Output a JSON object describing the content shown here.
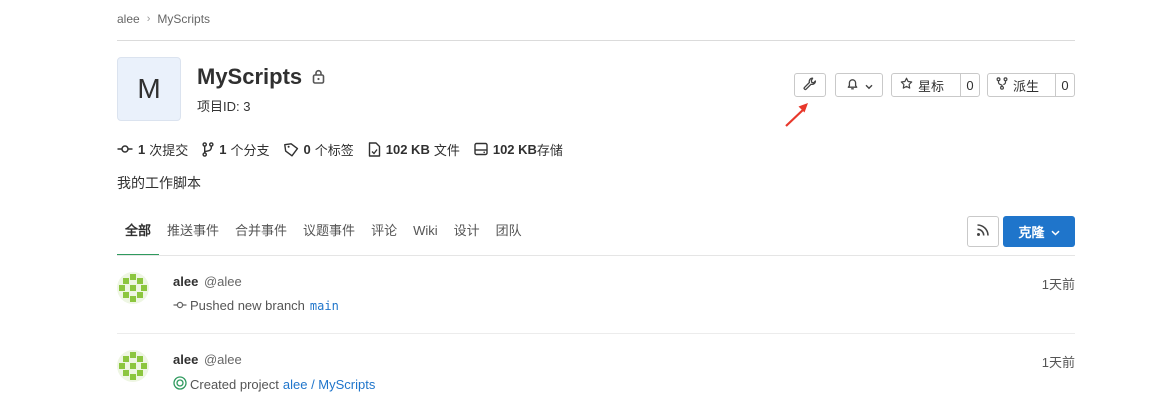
{
  "breadcrumb": {
    "user": "alee",
    "separator": "›",
    "project": "MyScripts"
  },
  "project": {
    "avatar_letter": "M",
    "title": "MyScripts",
    "id_label": "项目ID: 3",
    "description": "我的工作脚本"
  },
  "actions": {
    "star_label": "星标",
    "star_count": "0",
    "fork_label": "派生",
    "fork_count": "0",
    "annotation_color": "#e8382b"
  },
  "stats": [
    {
      "icon": "commit-icon",
      "value": "1",
      "label": "次提交"
    },
    {
      "icon": "branch-icon",
      "value": "1",
      "label": "个分支"
    },
    {
      "icon": "tag-icon",
      "value": "0",
      "label": "个标签"
    },
    {
      "icon": "file-icon",
      "value": "102 KB",
      "label": "文件"
    },
    {
      "icon": "storage-icon",
      "value": "102 KB",
      "label": "存储"
    }
  ],
  "tabs": [
    "全部",
    "推送事件",
    "合并事件",
    "议题事件",
    "评论",
    "Wiki",
    "设计",
    "团队"
  ],
  "clone_label": "克隆",
  "events": [
    {
      "name": "alee",
      "handle": "@alee",
      "time": "1天前",
      "action": "Pushed new branch",
      "target": "main"
    },
    {
      "name": "alee",
      "handle": "@alee",
      "time": "1天前",
      "action": "Created project",
      "target": "alee / MyScripts"
    }
  ],
  "colors": {
    "primary": "#1f75cb",
    "active_tab": "#2f9a5e",
    "avatar_green": "#8cc63f"
  }
}
